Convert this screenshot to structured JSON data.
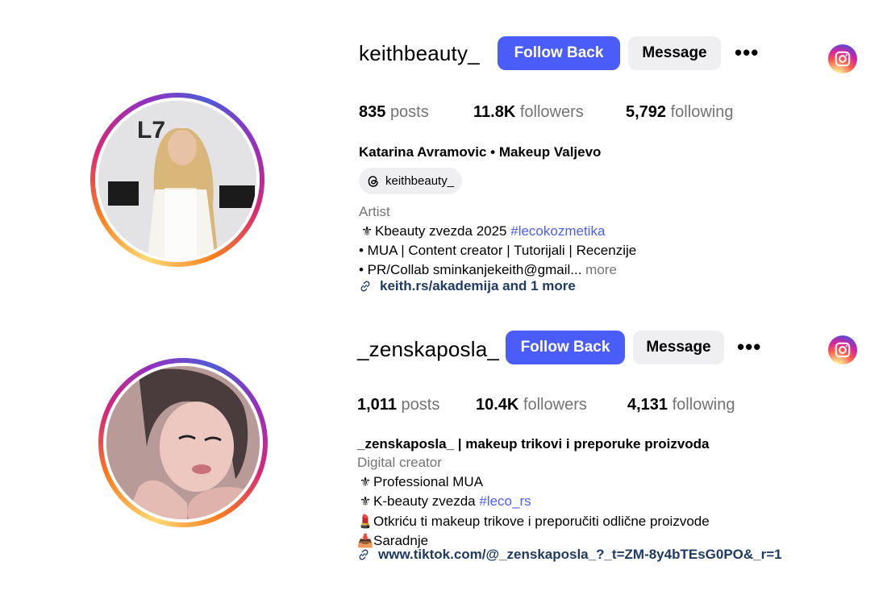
{
  "profiles": [
    {
      "username": "keithbeauty_",
      "follow_label": "Follow Back",
      "message_label": "Message",
      "more_label": "•••",
      "stats": {
        "posts": "835",
        "posts_label": "posts",
        "followers": "11.8K",
        "followers_label": "followers",
        "following": "5,792",
        "following_label": "following"
      },
      "full_name": "Katarina Avramovic • Makeup Valjevo",
      "threads_handle": "keithbeauty_",
      "category": "Artist",
      "bio_lines": [
        {
          "emoji": "⚜",
          "text": "Kbeauty zvezda 2025 ",
          "hashtag": "#lecokozmetika"
        },
        {
          "text": "• MUA | Content creator | Tutorijali | Recenzije"
        },
        {
          "text": "• PR/Collab sminkanjekeith@gmail...",
          "more": " more"
        }
      ],
      "link": "keith.rs/akademija and 1 more",
      "icons": {
        "avatar": "avatar",
        "threads": "threads-icon",
        "link": "link-icon",
        "instagram": "instagram-icon"
      }
    },
    {
      "username": "_zenskaposla_",
      "follow_label": "Follow Back",
      "message_label": "Message",
      "more_label": "•••",
      "stats": {
        "posts": "1,011",
        "posts_label": "posts",
        "followers": "10.4K",
        "followers_label": "followers",
        "following": "4,131",
        "following_label": "following"
      },
      "full_name": "_zenskaposla_ | makeup trikovi i preporuke proizvoda",
      "category": "Digital creator",
      "bio_lines": [
        {
          "emoji": "⚜",
          "text": "Professional MUA"
        },
        {
          "emoji": "⚜",
          "text": "K-beauty zvezda ",
          "hashtag": "#leco_rs"
        },
        {
          "emoji": "💄",
          "text": "Otkriću ti makeup trikove i preporučiti odlične proizvode"
        },
        {
          "emoji": "📥",
          "text": "Saradnje"
        }
      ],
      "link": "www.tiktok.com/@_zenskaposla_?_t=ZM-8y4bTEsG0PO&_r=1",
      "icons": {
        "avatar": "avatar",
        "link": "link-icon",
        "instagram": "instagram-icon"
      }
    }
  ]
}
